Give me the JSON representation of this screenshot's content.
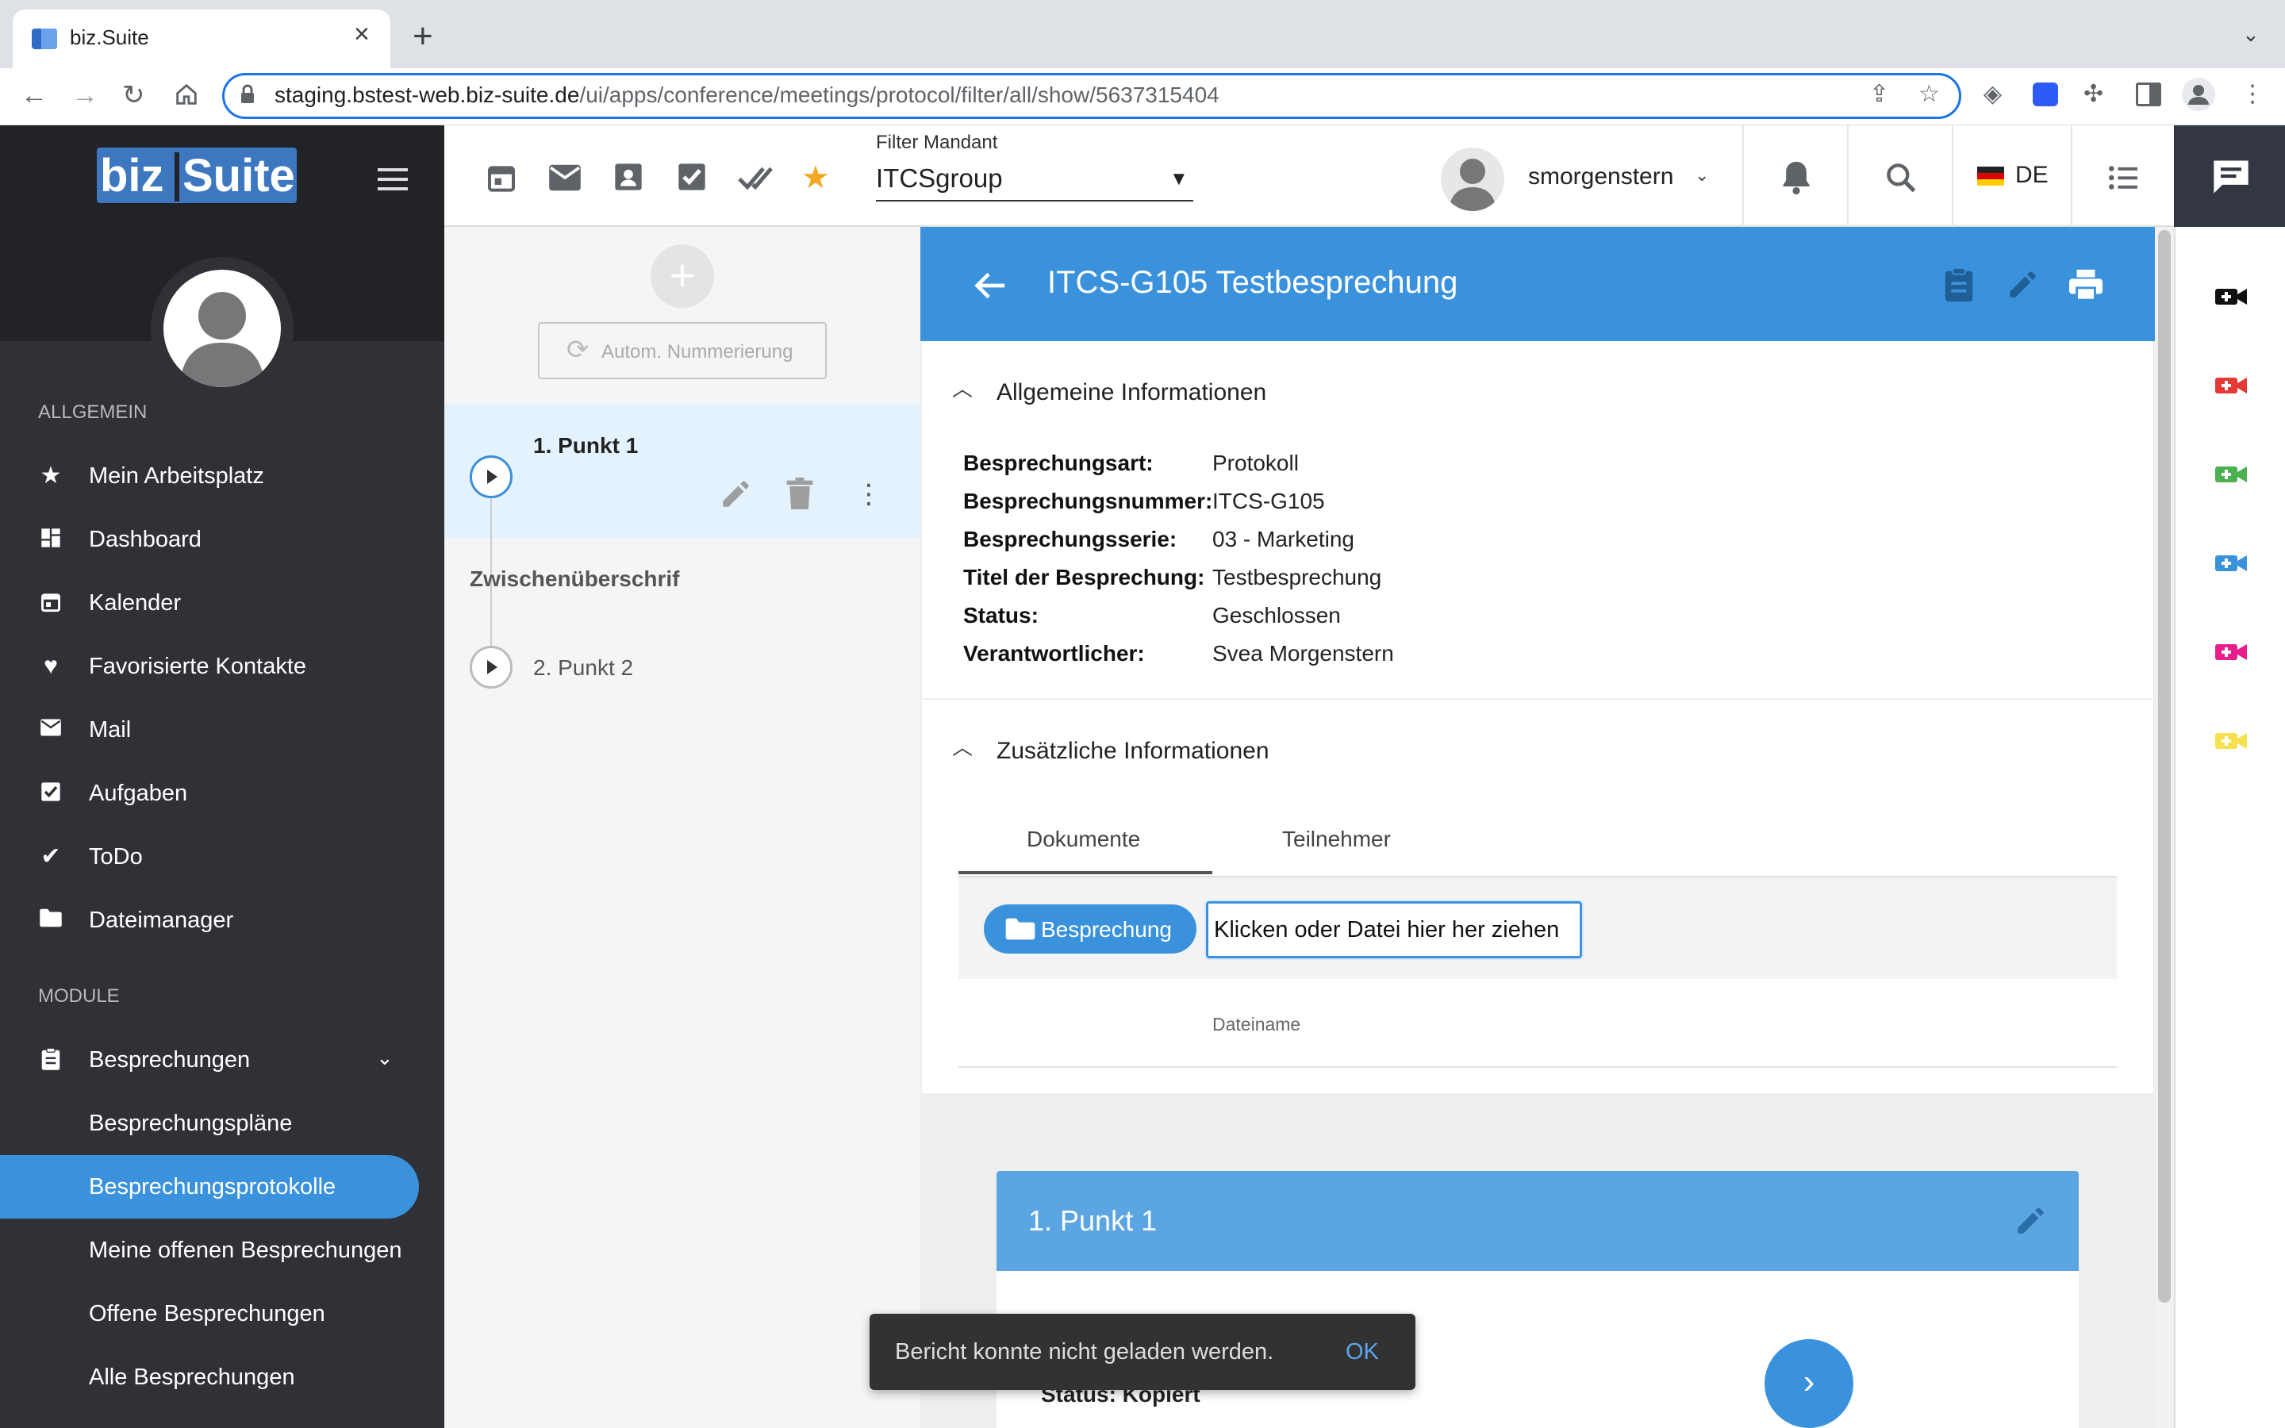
{
  "browser": {
    "tab_title": "biz.Suite",
    "url_host": "staging.bstest-web.biz-suite.de",
    "url_path": "/ui/apps/conference/meetings/protocol/filter/all/show/5637315404"
  },
  "sidebar": {
    "logo_part1": "biz",
    "logo_part2": "Suite",
    "section_general": "ALLGEMEIN",
    "general_items": [
      {
        "label": "Mein Arbeitsplatz",
        "icon": "star-icon"
      },
      {
        "label": "Dashboard",
        "icon": "dashboard-icon"
      },
      {
        "label": "Kalender",
        "icon": "calendar-icon"
      },
      {
        "label": "Favorisierte Kontakte",
        "icon": "heart-icon"
      },
      {
        "label": "Mail",
        "icon": "mail-icon"
      },
      {
        "label": "Aufgaben",
        "icon": "checkbox-icon"
      },
      {
        "label": "ToDo",
        "icon": "double-check-icon"
      },
      {
        "label": "Dateimanager",
        "icon": "folder-icon"
      }
    ],
    "section_modules": "MODULE",
    "module_items": [
      {
        "label": "Besprechungen",
        "icon": "clipboard-icon"
      },
      {
        "label": "Besprechungspläne"
      },
      {
        "label": "Besprechungsprotokolle"
      },
      {
        "label": "Meine offenen Besprechungen"
      },
      {
        "label": "Offene Besprechungen"
      },
      {
        "label": "Alle Besprechungen"
      }
    ]
  },
  "header": {
    "filter_label": "Filter Mandant",
    "filter_value": "ITCSgroup",
    "username": "smorgenstern",
    "language": "DE"
  },
  "list_panel": {
    "autonum_label": "Autom. Nummerierung",
    "item1_label": "1. Punkt 1",
    "subheading": "Zwischenüberschrif",
    "item2_label": "2. Punkt 2"
  },
  "detail": {
    "title": "ITCS-G105 Testbesprechung",
    "section_general": "Allgemeine Informationen",
    "info_rows": [
      {
        "key": "Besprechungsart:",
        "value": "Protokoll"
      },
      {
        "key": "Besprechungsnummer:",
        "value": "ITCS-G105"
      },
      {
        "key": "Besprechungsserie:",
        "value": "03 - Marketing"
      },
      {
        "key": "Titel der Besprechung:",
        "value": "Testbesprechung"
      },
      {
        "key": "Status:",
        "value": "Geschlossen"
      },
      {
        "key": "Verantwortlicher:",
        "value": "Svea Morgenstern"
      }
    ],
    "section_additional": "Zusätzliche Informationen",
    "tabs": [
      "Dokumente",
      "Teilnehmer"
    ],
    "upload_button": "Besprechung",
    "drop_zone": "Klicken oder Datei hier her ziehen",
    "column_filename": "Dateiname",
    "point_title": "1. Punkt 1",
    "point_status": "Status: Kopiert"
  },
  "snackbar": {
    "message": "Bericht konnte nicht geladen werden.",
    "action": "OK"
  },
  "colors": {
    "accent": "#3a92dc",
    "sidebar": "#2f3136",
    "camera_icons": [
      "#111111",
      "#e53935",
      "#4caf50",
      "#3a92dc",
      "#e91e8c",
      "#f5e050"
    ]
  }
}
